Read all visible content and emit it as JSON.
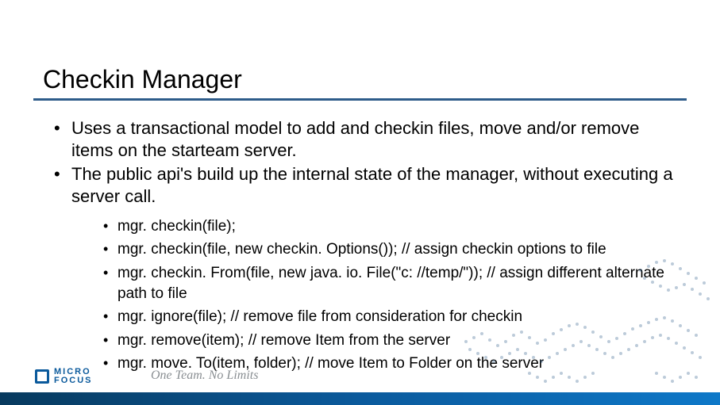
{
  "title": "Checkin Manager",
  "bullets": [
    "Uses a transactional model to add and checkin files, move and/or remove items on the starteam server.",
    "The public api's build up the internal state of the manager, without executing a server call."
  ],
  "subbullets": [
    "mgr. checkin(file);",
    "mgr. checkin(file, new checkin. Options());  // assign checkin options to file",
    "mgr. checkin. From(file, new java. io. File(\"c: //temp/\"));  // assign different alternate path to file",
    "mgr. ignore(file);  // remove file from consideration for checkin",
    "mgr. remove(item); // remove Item from the server",
    "mgr. move. To(item, folder); // move Item to Folder on the server"
  ],
  "logo": {
    "line1": "MICRO",
    "line2": "FOCUS"
  },
  "tagline": "One Team. No Limits"
}
